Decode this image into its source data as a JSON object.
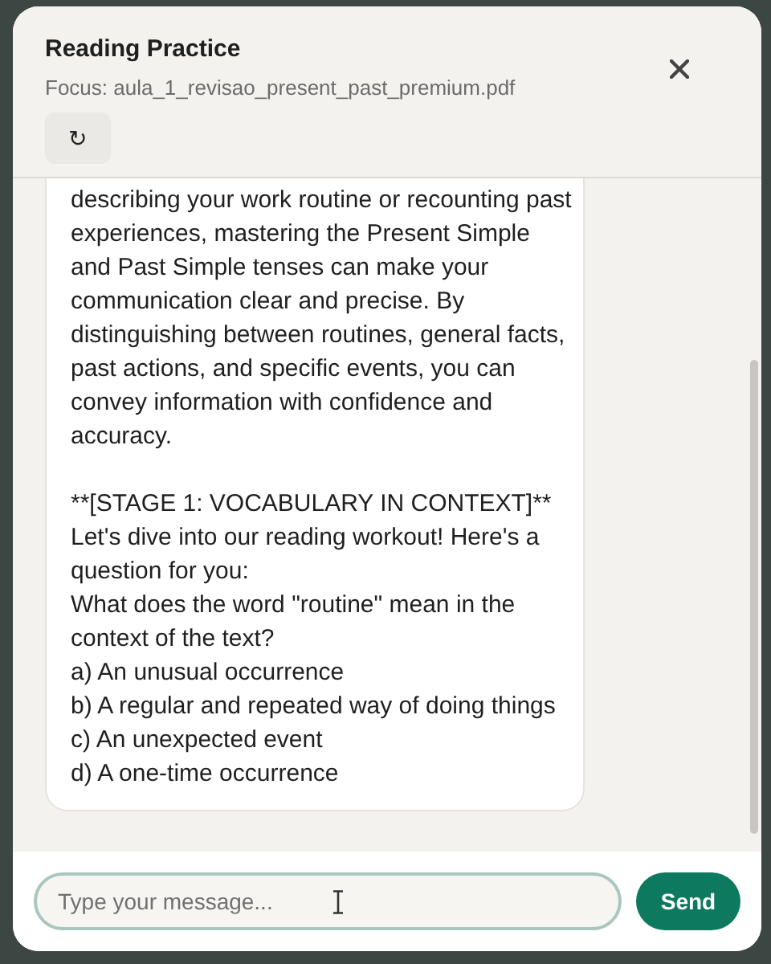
{
  "header": {
    "title": "Reading Practice",
    "focus": "Focus: aula_1_revisao_present_past_premium.pdf",
    "refresh_button": "↻"
  },
  "message": {
    "paragraph": "describing your work routine or recounting past experiences, mastering the Present Simple and Past Simple tenses can make your communication clear and precise. By distinguishing between routines, general facts, past actions, and specific events, you can convey information with confidence and accuracy.",
    "lines": [
      "**[STAGE 1: VOCABULARY IN CONTEXT]**",
      "Let's dive into our reading workout! Here's a question for you:",
      "What does the word \"routine\" mean in the context of the text?",
      "a) An unusual occurrence",
      "b) A regular and repeated way of doing things",
      "c) An unexpected event",
      "d) A one-time occurrence"
    ]
  },
  "composer": {
    "placeholder": "Type your message...",
    "send_button": "Send"
  }
}
